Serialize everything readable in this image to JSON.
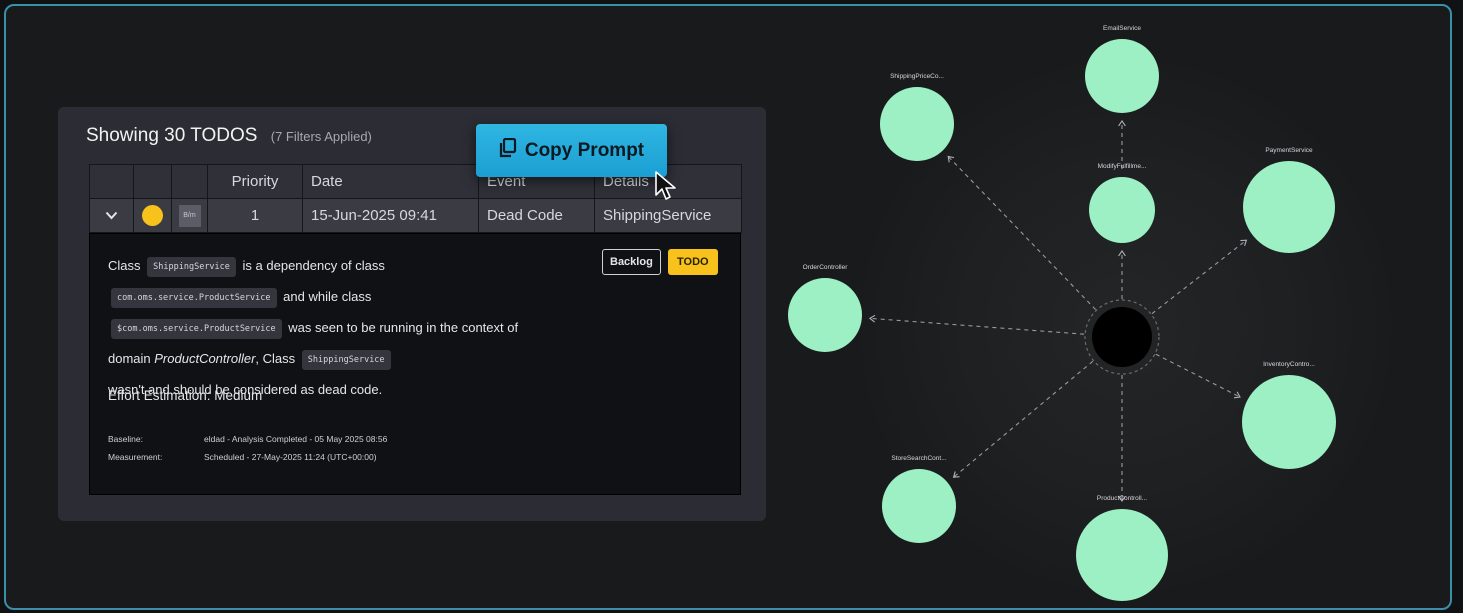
{
  "panel": {
    "title_count": "Showing 30 TODOS",
    "title_filters": "(7 Filters Applied)",
    "columns": [
      "Priority",
      "Date",
      "Event",
      "Details"
    ],
    "row": {
      "badge": "B/m",
      "priority": "1",
      "date": "15-Jun-2025 09:41",
      "event": "Dead Code",
      "details": "ShippingService",
      "status_color": "#f7c21b"
    },
    "detail": {
      "t1": "Class",
      "c1": "ShippingService",
      "t2": "is a dependency of class",
      "c2": "com.oms.service.ProductService",
      "t3": "and while class",
      "c3": "$com.oms.service.ProductService",
      "t4": "was seen to be running in the context of domain",
      "domain": "ProductController",
      "t5": ", Class",
      "c4": "ShippingService",
      "t6": "wasn't and should be considered as dead code.",
      "effort": "Effort Estimation: Medium",
      "baseline_label": "Baseline:",
      "baseline_value": "eldad - Analysis Completed - 05 May 2025 08:56",
      "measurement_label": "Measurement:",
      "measurement_value": "Scheduled - 27-May-2025 11:24 (UTC+00:00)"
    },
    "backlog_label": "Backlog",
    "todo_label": "TODO"
  },
  "copy_prompt": {
    "label": "Copy Prompt",
    "icon": "copy-icon",
    "color": "#1fa8db"
  },
  "graph": {
    "node_color": "#9cf0c4",
    "center_color": "#000000",
    "nodes": [
      {
        "label": "EmailService"
      },
      {
        "label": "ShippingPriceCo..."
      },
      {
        "label": "ModifyFulfillme..."
      },
      {
        "label": "PaymentService"
      },
      {
        "label": "OrderController"
      },
      {
        "label": "InventoryContro..."
      },
      {
        "label": "StoreSearchCont..."
      },
      {
        "label": "ProductControll..."
      }
    ]
  },
  "colors": {
    "accent": "#f7c21b",
    "border": "#3b8fa6"
  }
}
